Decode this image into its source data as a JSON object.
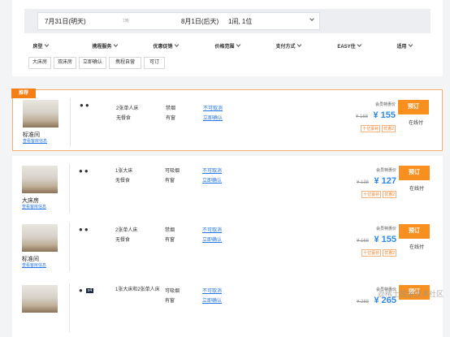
{
  "search": {
    "checkin": "7月31日(明天)",
    "nights": "1晚",
    "checkout": "8月1日(后天)",
    "rooms_guests": "1间, 1位"
  },
  "filters": [
    "房型",
    "携程服务",
    "优惠促销",
    "价格范围",
    "支付方式",
    "EASY住",
    "适用"
  ],
  "tags": [
    "大床房",
    "双床房",
    "立即确认",
    "携程自营",
    "可订"
  ],
  "recommend_badge": "推荐",
  "colors": {
    "accent": "#f7901e",
    "price": "#2e88e8",
    "link": "#2577e3",
    "badge": "#f57f17"
  },
  "rooms": [
    {
      "name": "标准间",
      "detail_link": "查看客房信息",
      "guests_icon": "two-person-icon",
      "bed": "2张单人床",
      "breakfast": "无餐食",
      "smoking": "禁烟",
      "window": "有窗",
      "cancel": "不可取消",
      "confirm": "立即确认",
      "member_label": "会员特惠价",
      "original_price": "¥ 168",
      "price": "¥ 155",
      "discount1": "十亿豪补",
      "discount2": "优惠2",
      "book": "预订",
      "pay": "在线付"
    },
    {
      "name": "大床房",
      "detail_link": "查看客房信息",
      "guests_icon": "two-person-icon",
      "bed": "1张大床",
      "breakfast": "无餐食",
      "smoking": "可吸烟",
      "window": "有窗",
      "cancel": "不可取消",
      "confirm": "立即确认",
      "member_label": "会员特惠价",
      "original_price": "¥ 138",
      "price": "¥ 127",
      "discount1": "十亿豪补",
      "discount2": "优惠2",
      "book": "预订",
      "pay": "在线付"
    },
    {
      "name": "标准间",
      "detail_link": "查看客房信息",
      "guests_icon": "two-person-icon",
      "bed": "2张单人床",
      "breakfast": "无餐食",
      "smoking": "禁烟",
      "window": "有窗",
      "cancel": "不可取消",
      "confirm": "立即确认",
      "member_label": "会员特惠价",
      "original_price": "¥ 168",
      "price": "¥ 155",
      "discount1": "十亿豪补",
      "discount2": "优惠2",
      "book": "预订",
      "pay": "在线付"
    },
    {
      "name": "",
      "detail_link": "",
      "guests_icon": "one-person-icon",
      "guest_count": "x4",
      "bed": "1张大床和2张单人床",
      "breakfast": "",
      "smoking": "可吸烟",
      "window": "有窗",
      "cancel": "不可取消",
      "confirm": "立即确认",
      "member_label": "会员特惠价",
      "original_price": "¥ 288",
      "price": "¥ 265",
      "discount1": "",
      "discount2": "",
      "book": "预订",
      "pay": ""
    }
  ],
  "watermark": "@稀土掘金技术社区"
}
